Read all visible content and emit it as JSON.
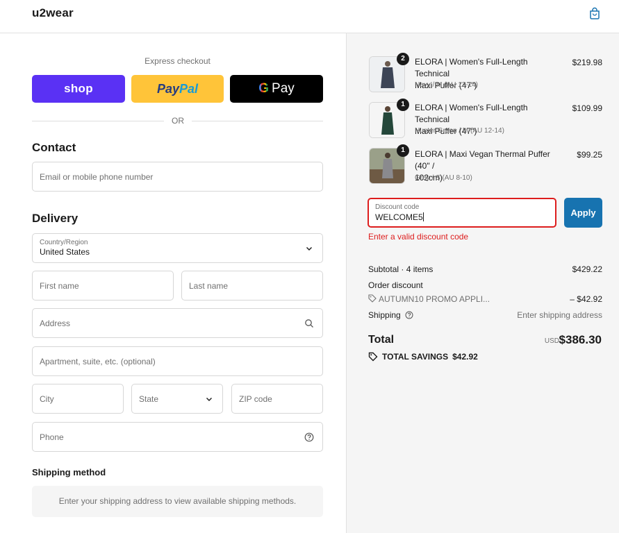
{
  "header": {
    "brand": "u2wear",
    "cart_icon": "shopping-bag-icon"
  },
  "express": {
    "label": "Express checkout",
    "shop_label": "shop",
    "paypal_part1": "Pay",
    "paypal_part2": "Pal",
    "gpay_g": "G",
    "gpay_label": "Pay",
    "or_label": "OR"
  },
  "contact": {
    "title": "Contact",
    "email_placeholder": "Email or mobile phone number"
  },
  "delivery": {
    "title": "Delivery",
    "country_label": "Country/Region",
    "country_value": "United States",
    "first_name_placeholder": "First name",
    "last_name_placeholder": "Last name",
    "address_placeholder": "Address",
    "apartment_placeholder": "Apartment, suite, etc. (optional)",
    "city_placeholder": "City",
    "state_placeholder": "State",
    "zip_placeholder": "ZIP code",
    "phone_placeholder": "Phone"
  },
  "shipping": {
    "title": "Shipping method",
    "message": "Enter your shipping address to view available shipping methods."
  },
  "order": {
    "items": [
      {
        "qty": "2",
        "name_line1": "ELORA | Women's Full-Length Technical",
        "name_line2": "Maxi Puffer (47\")",
        "variant": "Navy / M (AU 12-14)",
        "price": "$219.98",
        "color": "#3d4556"
      },
      {
        "qty": "1",
        "name_line1": "ELORA | Women's Full-Length Technical",
        "name_line2": "Maxi Puffer (47\")",
        "variant": "Hunter Green / M (AU 12-14)",
        "price": "$109.99",
        "color": "#24473a"
      },
      {
        "qty": "1",
        "name_line1": "ELORA | Maxi Vegan Thermal Puffer (40\" /",
        "name_line2": "102cm)",
        "variant": "Grey / S (AU 8-10)",
        "price": "$99.25",
        "color": "#8a8a8e"
      }
    ],
    "discount_label": "Discount code",
    "discount_value": "WELCOME5",
    "apply_label": "Apply",
    "error_message": "Enter a valid discount code",
    "subtotal_label": "Subtotal · 4 items",
    "subtotal_value": "$429.22",
    "order_discount_label": "Order discount",
    "promo_code": "AUTUMN10 PROMO APPLI...",
    "promo_value": "– $42.92",
    "shipping_label": "Shipping",
    "shipping_value": "Enter shipping address",
    "total_label": "Total",
    "total_currency": "USD",
    "total_value": "$386.30",
    "savings_label": "TOTAL SAVINGS",
    "savings_value": "$42.92"
  }
}
